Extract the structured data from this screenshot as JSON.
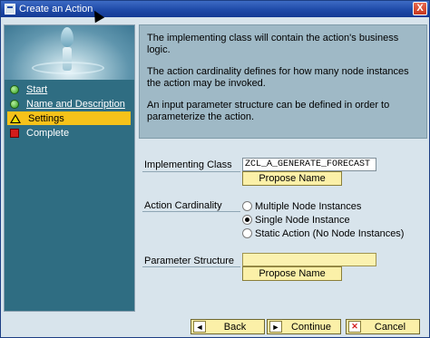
{
  "window": {
    "title": "Create an Action",
    "close_glyph": "X"
  },
  "steps": [
    {
      "label": "Start",
      "state": "done",
      "icon": "green-status-icon"
    },
    {
      "label": "Name and Description",
      "state": "done",
      "icon": "green-status-icon"
    },
    {
      "label": "Settings",
      "state": "current",
      "icon": "warning-icon"
    },
    {
      "label": "Complete",
      "state": "todo",
      "icon": "red-status-icon"
    }
  ],
  "info": {
    "p1": "The implementing class will contain the action's business logic.",
    "p2": "The action cardinality defines for how many node instances the action may be invoked.",
    "p3": "An input parameter structure can be defined in order to parameterize the action."
  },
  "form": {
    "implementing_class_label": "Implementing Class",
    "implementing_class_value": "ZCL_A_GENERATE_FORECAST",
    "propose_name_1": "Propose Name",
    "cardinality_label": "Action Cardinality",
    "cardinality_options": [
      {
        "label": "Multiple Node Instances",
        "selected": false
      },
      {
        "label": "Single Node Instance",
        "selected": true
      },
      {
        "label": "Static Action (No Node Instances)",
        "selected": false
      }
    ],
    "parameter_structure_label": "Parameter Structure",
    "parameter_structure_value": "",
    "propose_name_2": "Propose Name"
  },
  "buttons": {
    "back": "Back",
    "continue": "Continue",
    "cancel": "Cancel",
    "back_icon": "◄",
    "continue_icon": "►",
    "cancel_icon": "✕"
  }
}
